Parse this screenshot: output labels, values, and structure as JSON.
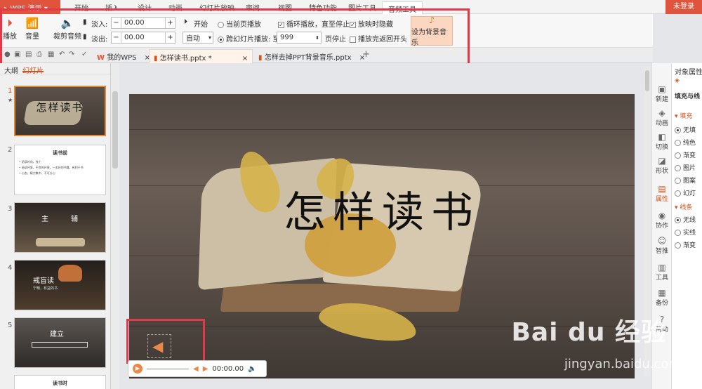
{
  "app": {
    "title": "WPS 演示",
    "login": "未登录"
  },
  "menu": [
    "开始",
    "插入",
    "设计",
    "动画",
    "幻灯片放映",
    "审阅",
    "视图",
    "特色功能",
    "图片工具",
    "音频工具"
  ],
  "ribbon": {
    "play": "播放",
    "volume": "音量",
    "trim": "裁剪音频",
    "fade_in_label": "淡入:",
    "fade_in_value": "00.00",
    "fade_out_label": "淡出:",
    "fade_out_value": "00.00",
    "start_label": "开始",
    "start_value": "自动",
    "current_page": "当前页播放",
    "cross_slide": "跨幻灯片播放: 至",
    "cross_value": "999",
    "page_stop": "页停止",
    "loop": "循环播放，直至停止",
    "hide": "放映时隐藏",
    "rewind": "播放完返回开头",
    "set_bg_music": "设为背景音乐"
  },
  "doc_tabs": [
    "我的WPS",
    "怎样读书.pptx *",
    "怎样去掉PPT背景音乐.pptx"
  ],
  "left_panel": {
    "tab_outline": "大纲",
    "tab_slides": "幻灯片"
  },
  "thumbs": [
    {
      "num": "1",
      "title": "怎样读书"
    },
    {
      "num": "2",
      "title": "读书前",
      "lines": [
        "• 阅读时间，找个",
        "• 阅读环境，不良的环境，一本好的书籍，有利于书",
        "• 心态，精力集中，不可分心"
      ]
    },
    {
      "num": "3",
      "title_l": "主",
      "title_r": "辅"
    },
    {
      "num": "4",
      "title": "戒盲读",
      "sub": "宁精，有益的书"
    },
    {
      "num": "5",
      "title": "建立"
    },
    {
      "num": "6",
      "title": "读书时"
    }
  ],
  "slide": {
    "title": "怎样读书"
  },
  "player": {
    "time": "00:00.00"
  },
  "right_bar": [
    "新建",
    "动画",
    "切换",
    "形状",
    "属性",
    "协作",
    "智推",
    "工具",
    "备份",
    "帮助"
  ],
  "props": {
    "header": "对象属性",
    "tab": "填充与线",
    "fill_section": "填充",
    "fill_opts": [
      "无填",
      "纯色",
      "渐变",
      "图片",
      "图案",
      "幻灯"
    ],
    "line_section": "线条",
    "line_opts": [
      "无线",
      "实线",
      "渐变"
    ]
  },
  "watermark": {
    "brand": "Bai du 经验",
    "url": "jingyan.baidu.com"
  },
  "colors": {
    "accent": "#e0533c",
    "highlight": "#e0394a"
  }
}
